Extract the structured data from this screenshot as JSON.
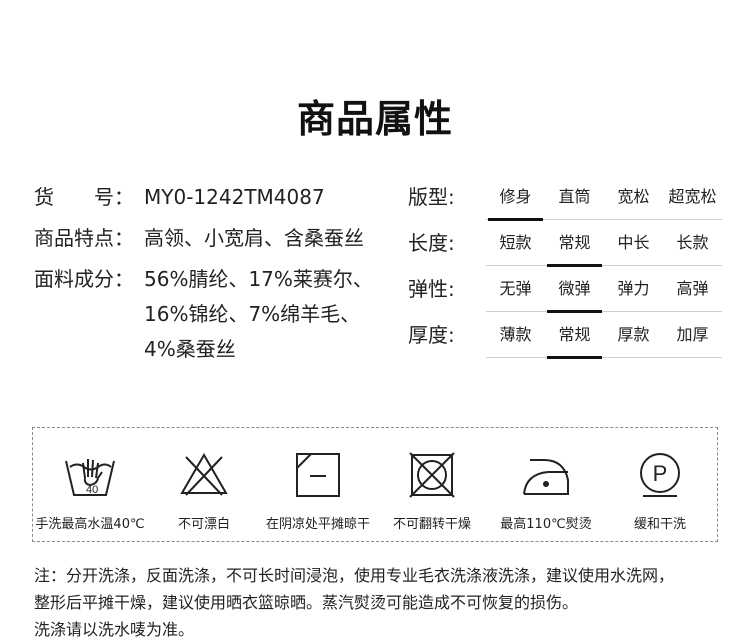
{
  "title": "商品属性",
  "info": [
    {
      "label": "货　　号：",
      "value": "MY0-1242TM4087"
    },
    {
      "label": "商品特点：",
      "value": "高领、小宽肩、含桑蚕丝"
    },
    {
      "label": "面料成分：",
      "value": "56%腈纶、17%莱赛尔、16%锦纶、7%绵羊毛、4%桑蚕丝"
    }
  ],
  "attributes": [
    {
      "label": "版型:",
      "options": [
        "修身",
        "直筒",
        "宽松",
        "超宽松"
      ],
      "selected": "修身"
    },
    {
      "label": "长度:",
      "options": [
        "短款",
        "常规",
        "中长",
        "长款"
      ],
      "selected": "常规"
    },
    {
      "label": "弹性:",
      "options": [
        "无弹",
        "微弹",
        "弹力",
        "高弹"
      ],
      "selected": "微弹"
    },
    {
      "label": "厚度:",
      "options": [
        "薄款",
        "常规",
        "厚款",
        "加厚"
      ],
      "selected": "常规"
    }
  ],
  "care": [
    {
      "icon": "hand-wash-icon",
      "label": "手洗最高水温40℃",
      "temp": "40"
    },
    {
      "icon": "no-bleach-icon",
      "label": "不可漂白"
    },
    {
      "icon": "shade-flat-dry-icon",
      "label": "在阴凉处平摊晾干"
    },
    {
      "icon": "no-tumble-dry-icon",
      "label": "不可翻转干燥"
    },
    {
      "icon": "iron-icon",
      "label": "最高110℃熨烫"
    },
    {
      "icon": "dry-clean-p-icon",
      "label": "缓和干洗",
      "symbol": "P"
    }
  ],
  "note": {
    "line1": "注：分开洗涤，反面洗涤，不可长时间浸泡，使用专业毛衣洗涤液洗涤，建议使用水洗网，",
    "line2": "整形后平摊干燥，建议使用晒衣篮晾晒。蒸汽熨烫可能造成不可恢复的损伤。",
    "line3": "洗涤请以洗水唛为准。"
  }
}
